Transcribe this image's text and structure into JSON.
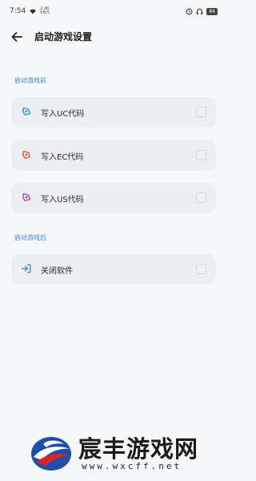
{
  "status_bar": {
    "time": "7:54",
    "net_speed": "2.46 KB/S",
    "battery": "84"
  },
  "header": {
    "back_icon": "arrow-left-icon",
    "title": "启动游戏设置"
  },
  "sections": [
    {
      "label": "启动游戏前",
      "items": [
        {
          "label": "写入UC代码",
          "icon": "share-icon",
          "icon_color": "#3b8fd6",
          "checked": false
        },
        {
          "label": "写入EC代码",
          "icon": "share-icon",
          "icon_color": "#e0533c",
          "checked": false
        },
        {
          "label": "写入US代码",
          "icon": "share-icon",
          "icon_color": "#8a4fc7",
          "checked": false
        }
      ]
    },
    {
      "label": "启动游戏后",
      "items": [
        {
          "label": "关闭软件",
          "icon": "exit-icon",
          "icon_color": "#3b8fd6",
          "checked": false
        }
      ]
    }
  ],
  "watermark": {
    "name": "宸丰游戏网",
    "url": "www.wxcff.net",
    "colors": {
      "blue": "#1b4fa8",
      "red": "#d8232a"
    }
  },
  "colors": {
    "background": "#f6f7f9",
    "card": "#eceef2",
    "section_label": "#3f86c9"
  }
}
